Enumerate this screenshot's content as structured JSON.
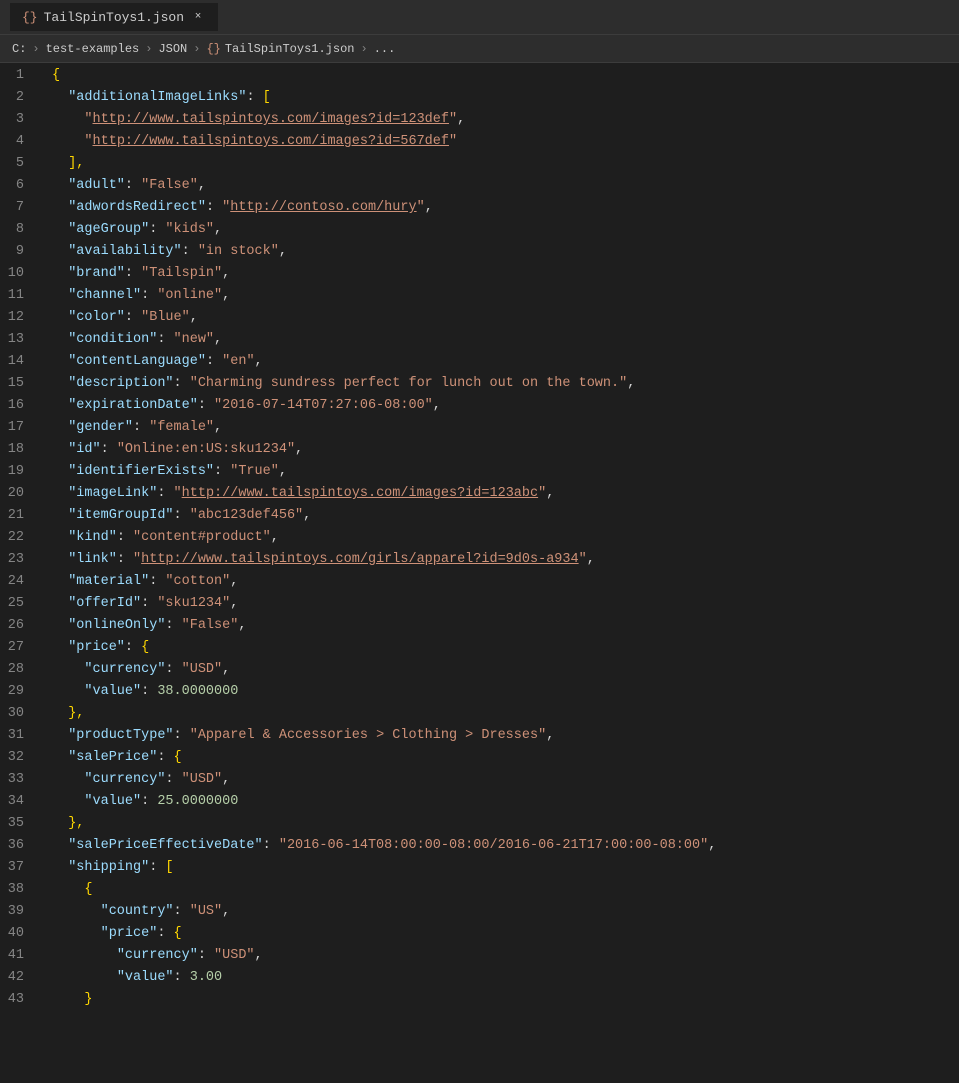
{
  "tab": {
    "icon": "{}",
    "label": "TailSpinToys1.json",
    "close_label": "×"
  },
  "breadcrumb": {
    "items": [
      "C:",
      "test-examples",
      "JSON",
      "TailSpinToys1.json",
      "..."
    ],
    "icon": "{}"
  },
  "lines": [
    {
      "num": 1,
      "content": "{"
    },
    {
      "num": 2,
      "content": "  \"additionalImageLinks\": ["
    },
    {
      "num": 3,
      "content": "    \"http://www.tailspintoys.com/images?id=123def\","
    },
    {
      "num": 4,
      "content": "    \"http://www.tailspintoys.com/images?id=567def\""
    },
    {
      "num": 5,
      "content": "  ],"
    },
    {
      "num": 6,
      "content": "  \"adult\": \"False\","
    },
    {
      "num": 7,
      "content": "  \"adwordsRedirect\": \"http://contoso.com/hury\","
    },
    {
      "num": 8,
      "content": "  \"ageGroup\": \"kids\","
    },
    {
      "num": 9,
      "content": "  \"availability\": \"in stock\","
    },
    {
      "num": 10,
      "content": "  \"brand\": \"Tailspin\","
    },
    {
      "num": 11,
      "content": "  \"channel\": \"online\","
    },
    {
      "num": 12,
      "content": "  \"color\": \"Blue\","
    },
    {
      "num": 13,
      "content": "  \"condition\": \"new\","
    },
    {
      "num": 14,
      "content": "  \"contentLanguage\": \"en\","
    },
    {
      "num": 15,
      "content": "  \"description\": \"Charming sundress perfect for lunch out on the town.\","
    },
    {
      "num": 16,
      "content": "  \"expirationDate\": \"2016-07-14T07:27:06-08:00\","
    },
    {
      "num": 17,
      "content": "  \"gender\": \"female\","
    },
    {
      "num": 18,
      "content": "  \"id\": \"Online:en:US:sku1234\","
    },
    {
      "num": 19,
      "content": "  \"identifierExists\": \"True\","
    },
    {
      "num": 20,
      "content": "  \"imageLink\": \"http://www.tailspintoys.com/images?id=123abc\","
    },
    {
      "num": 21,
      "content": "  \"itemGroupId\": \"abc123def456\","
    },
    {
      "num": 22,
      "content": "  \"kind\": \"content#product\","
    },
    {
      "num": 23,
      "content": "  \"link\": \"http://www.tailspintoys.com/girls/apparel?id=9d0s-a934\","
    },
    {
      "num": 24,
      "content": "  \"material\": \"cotton\","
    },
    {
      "num": 25,
      "content": "  \"offerId\": \"sku1234\","
    },
    {
      "num": 26,
      "content": "  \"onlineOnly\": \"False\","
    },
    {
      "num": 27,
      "content": "  \"price\": {"
    },
    {
      "num": 28,
      "content": "    \"currency\": \"USD\","
    },
    {
      "num": 29,
      "content": "    \"value\": 38.0000000"
    },
    {
      "num": 30,
      "content": "  },"
    },
    {
      "num": 31,
      "content": "  \"productType\": \"Apparel & Accessories > Clothing > Dresses\","
    },
    {
      "num": 32,
      "content": "  \"salePrice\": {"
    },
    {
      "num": 33,
      "content": "    \"currency\": \"USD\","
    },
    {
      "num": 34,
      "content": "    \"value\": 25.0000000"
    },
    {
      "num": 35,
      "content": "  },"
    },
    {
      "num": 36,
      "content": "  \"salePriceEffectiveDate\": \"2016-06-14T08:00:00-08:00/2016-06-21T17:00:00-08:00\","
    },
    {
      "num": 37,
      "content": "  \"shipping\": ["
    },
    {
      "num": 38,
      "content": "    {"
    },
    {
      "num": 39,
      "content": "      \"country\": \"US\","
    },
    {
      "num": 40,
      "content": "      \"price\": {"
    },
    {
      "num": 41,
      "content": "        \"currency\": \"USD\","
    },
    {
      "num": 42,
      "content": "        \"value\": 3.00"
    },
    {
      "num": 43,
      "content": "    }"
    }
  ]
}
